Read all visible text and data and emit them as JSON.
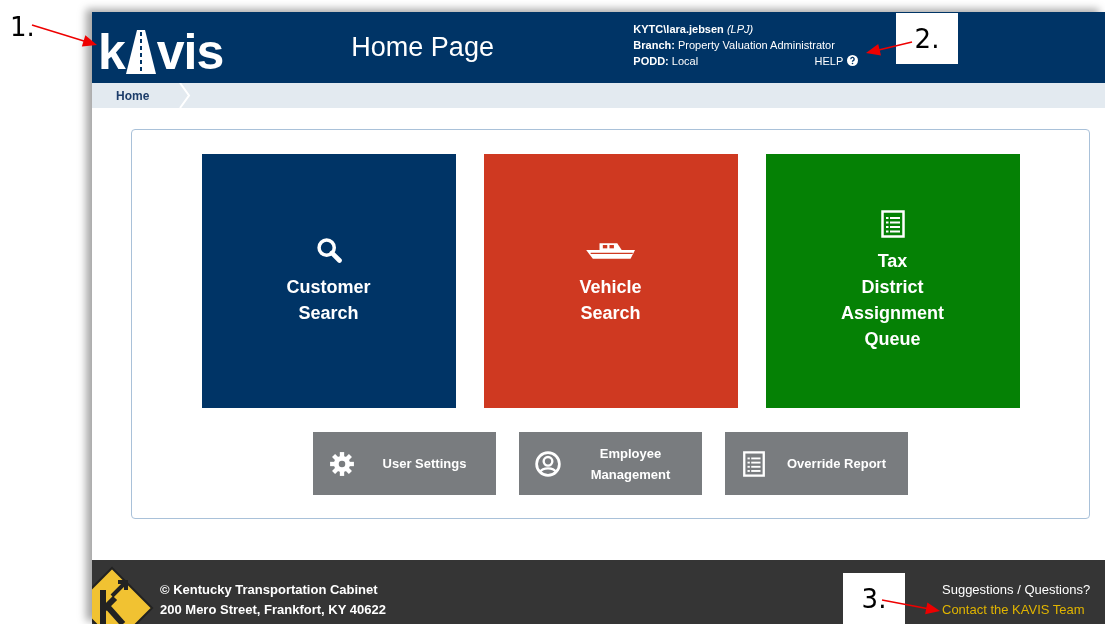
{
  "header": {
    "logo": {
      "left": "k",
      "right": "vis"
    },
    "title": "Home Page",
    "user": {
      "account": "KYTC\\lara.jebsen",
      "role": "(LPJ)"
    },
    "info": [
      {
        "label": "Branch:",
        "value": "Property Valuation Administrator"
      },
      {
        "label": "PODD:",
        "value": "Local"
      }
    ],
    "help": "HELP"
  },
  "breadcrumb": [
    {
      "label": "Home"
    }
  ],
  "tiles": [
    {
      "color": "#003466",
      "lines": [
        "Customer",
        "Search"
      ]
    },
    {
      "color": "#cf3921",
      "lines": [
        "Vehicle",
        "Search"
      ]
    },
    {
      "color": "#058105",
      "lines": [
        "Tax",
        "District",
        "Assignment",
        "Queue"
      ]
    }
  ],
  "buttons": [
    {
      "lines": [
        "User Settings"
      ]
    },
    {
      "lines": [
        "Employee",
        "Management"
      ]
    },
    {
      "lines": [
        "Override Report"
      ]
    }
  ],
  "footer": {
    "copyright": "© Kentucky Transportation Cabinet",
    "address": "200 Mero Street, Frankfort, KY 40622",
    "prompt": "Suggestions / Questions?",
    "link": "Contact the KAVIS Team"
  },
  "annotations": [
    {
      "label": "1.",
      "kind": "plain"
    },
    {
      "label": "2.",
      "kind": "boxed"
    },
    {
      "label": "3.",
      "kind": "boxed"
    }
  ]
}
